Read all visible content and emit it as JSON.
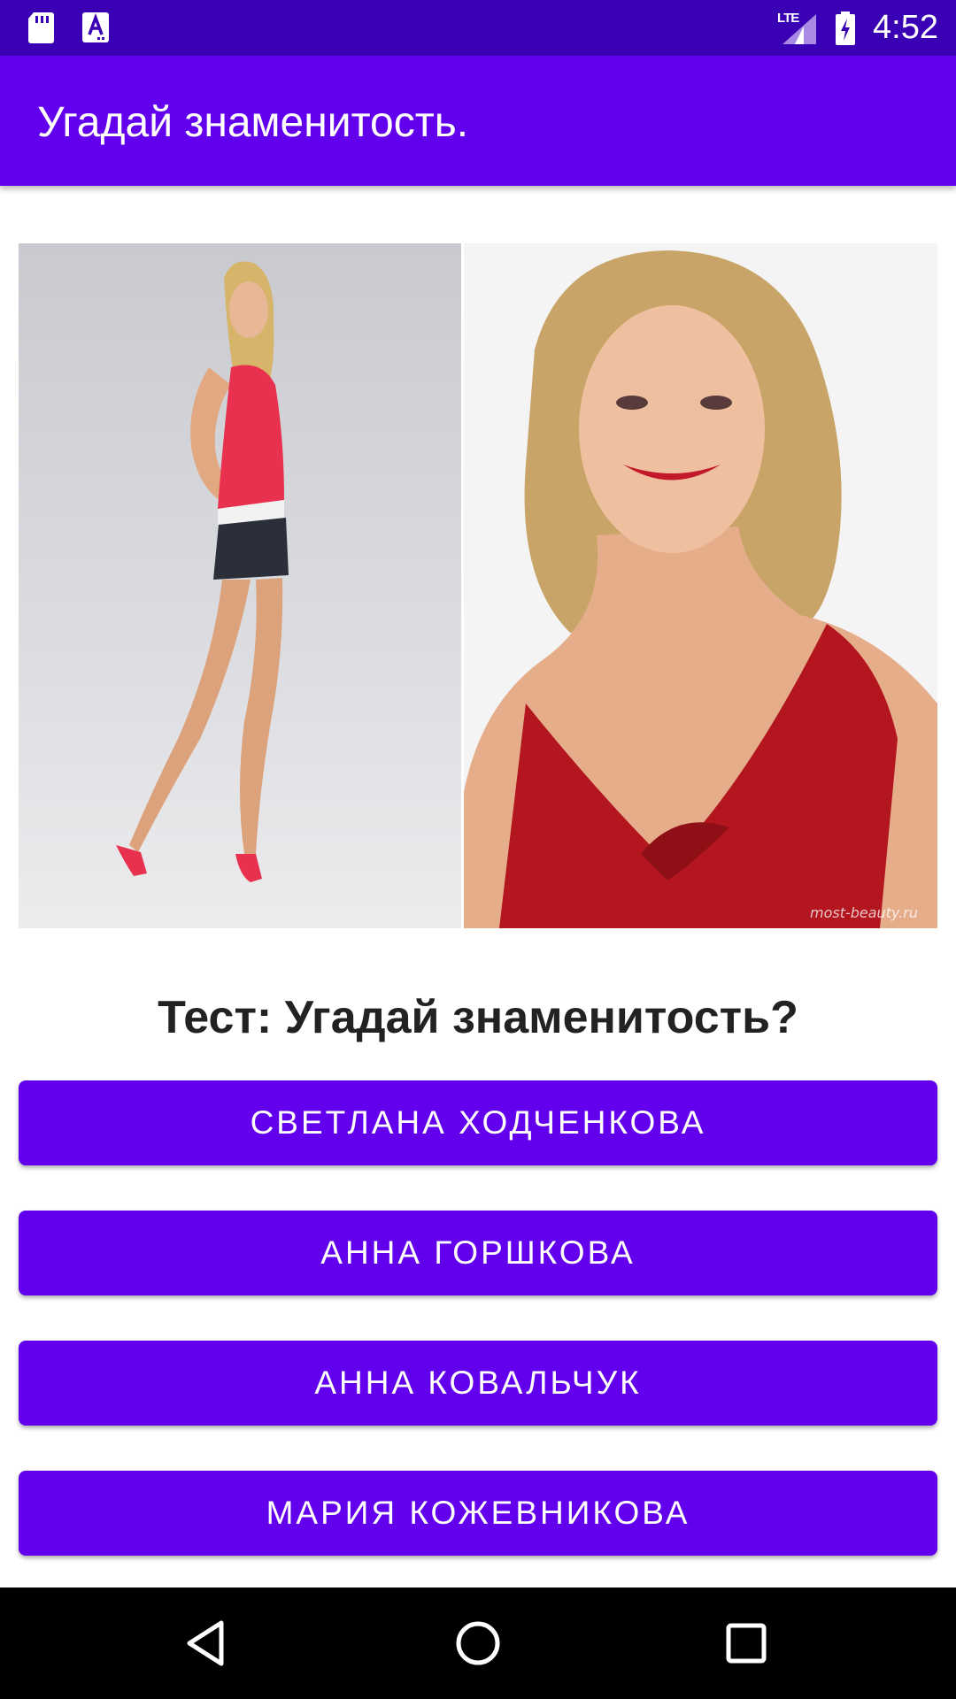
{
  "status_bar": {
    "time": "4:52",
    "network": "LTE",
    "icons": [
      "sd-card-icon",
      "text-app-icon",
      "signal-icon",
      "battery-charging-icon"
    ]
  },
  "app_bar": {
    "title": "Угадай знаменитость."
  },
  "images": {
    "left": "celebrity-photo-full-length",
    "right": "celebrity-photo-portrait",
    "watermark": "most-beauty.ru"
  },
  "question": "Тест: Угадай знаменитость?",
  "answers": [
    "СВЕТЛАНА ХОДЧЕНКОВА",
    "АННА ГОРШКОВА",
    "АННА КОВАЛЬЧУК",
    "МАРИЯ КОЖЕВНИКОВА"
  ],
  "nav_bar": {
    "icons": [
      "back-icon",
      "home-icon",
      "recents-icon"
    ]
  },
  "colors": {
    "status_bar": "#3a00b3",
    "primary": "#6200ee",
    "nav_bar": "#000000"
  }
}
